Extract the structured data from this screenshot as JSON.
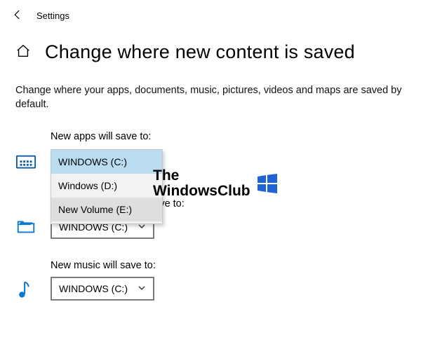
{
  "topbar": {
    "title": "Settings"
  },
  "page": {
    "title": "Change where new content is saved",
    "description": "Change where your apps, documents, music, pictures, videos and maps are saved by default."
  },
  "sections": {
    "apps": {
      "label": "New apps will save to:",
      "value": "WINDOWS (C:)",
      "dropdown": {
        "options": [
          "WINDOWS (C:)",
          "Windows (D:)",
          "New Volume (E:)"
        ]
      }
    },
    "documents": {
      "partial_label": "save to:",
      "value": "WINDOWS (C:)"
    },
    "music": {
      "label": "New music will save to:",
      "value": "WINDOWS (C:)"
    }
  },
  "watermark": {
    "line1": "The",
    "line2": "WindowsClub"
  }
}
